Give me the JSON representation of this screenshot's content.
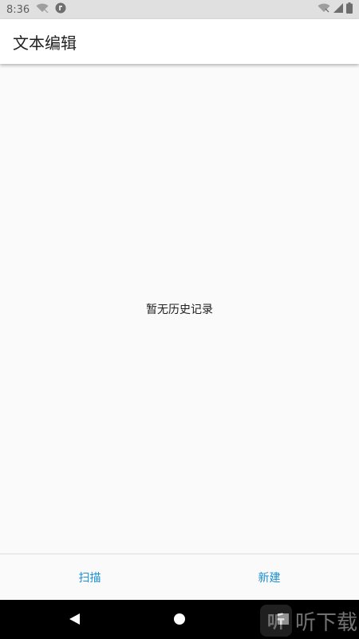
{
  "status_bar": {
    "time": "8:36",
    "left_icons": [
      "wifi-off-icon",
      "app-notification-icon"
    ],
    "right_icons": [
      "wifi-icon",
      "cellular-signal-icon",
      "battery-icon"
    ]
  },
  "app_bar": {
    "title": "文本编辑"
  },
  "main": {
    "empty_message": "暂无历史记录"
  },
  "bottom_bar": {
    "scan_label": "扫描",
    "new_label": "新建"
  },
  "nav_bar": {
    "icons": [
      "back-icon",
      "home-icon",
      "recents-icon"
    ]
  },
  "watermark": {
    "logo_text": "听",
    "text": "听下载"
  },
  "colors": {
    "accent": "#1a8fd4",
    "status_bar_bg": "#e0e0e0",
    "app_bar_bg": "#ffffff",
    "page_bg": "#fafafa",
    "nav_bar_bg": "#000000"
  }
}
